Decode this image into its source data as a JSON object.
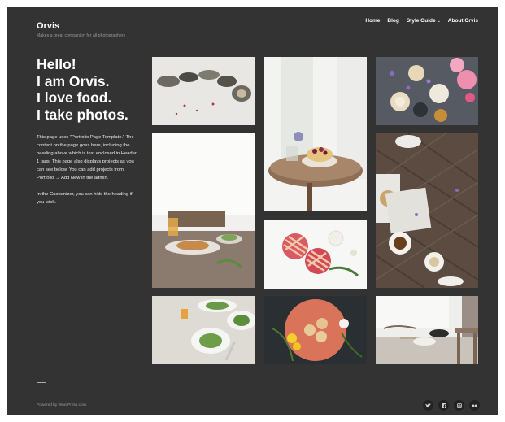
{
  "site": {
    "title": "Orvis",
    "tagline": "Makes a great companion for all photographers"
  },
  "nav": {
    "items": [
      {
        "label": "Home"
      },
      {
        "label": "Blog"
      },
      {
        "label": "Style Guide"
      },
      {
        "label": "About Orvis"
      }
    ],
    "dropdown_icon": "chevron-down-icon"
  },
  "hero": {
    "lines": [
      "Hello!",
      "I am Orvis.",
      "I love food.",
      "I take photos."
    ]
  },
  "intro": {
    "paragraph1": "This page uses \"Portfolio Page Template.\" The content on the page goes here, including the heading above which is text enclosed in Header 1 tags. This page also displays projects as you can see below. You can add projects from Portfolio → Add New in the admin.",
    "paragraph2": "In the Customizer, you can hide the heading if you wish."
  },
  "footer": {
    "powered_by": "Powered by WordPress.com.",
    "social_icons": [
      "twitter-icon",
      "facebook-icon",
      "instagram-icon",
      "flickr-icon"
    ]
  },
  "colors": {
    "background": "#333333",
    "text": "#ffffff",
    "muted": "#9a9a9a"
  }
}
